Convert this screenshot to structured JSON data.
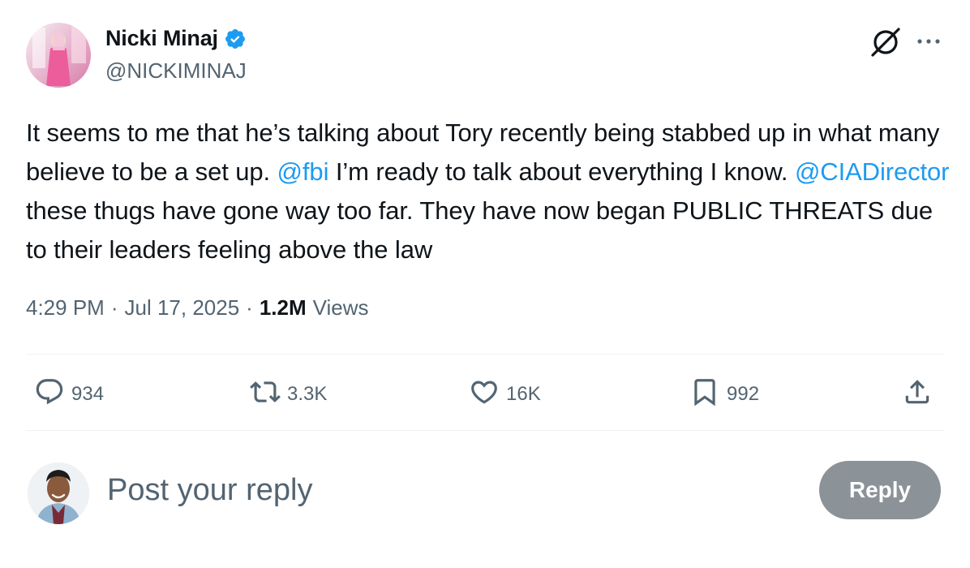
{
  "author": {
    "display_name": "Nicki Minaj",
    "handle": "@NICKIMINAJ",
    "verified": true,
    "verified_color": "#1d9bf0"
  },
  "header_icons": [
    "grok-icon",
    "more-options-icon"
  ],
  "tweet": {
    "segments": [
      {
        "text": "It seems to me that he’s talking about Tory recently being stabbed up in what many believe to be a set up. ",
        "type": "text"
      },
      {
        "text": "@fbi",
        "type": "mention"
      },
      {
        "text": " I’m ready to talk about everything I know. ",
        "type": "text"
      },
      {
        "text": "@CIADirector",
        "type": "mention"
      },
      {
        "text": " these thugs have gone way too far. They have now began PUBLIC THREATS due to their leaders feeling above the law",
        "type": "text"
      }
    ],
    "mention_color": "#1d9bf0"
  },
  "meta": {
    "time": "4:29 PM",
    "separator": "·",
    "date": "Jul 17, 2025",
    "views_count": "1.2M",
    "views_label": "Views"
  },
  "actions": {
    "replies": "934",
    "reposts": "3.3K",
    "likes": "16K",
    "bookmarks": "992"
  },
  "reply_box": {
    "placeholder": "Post your reply",
    "button_label": "Reply",
    "button_color": "#8b9298"
  }
}
